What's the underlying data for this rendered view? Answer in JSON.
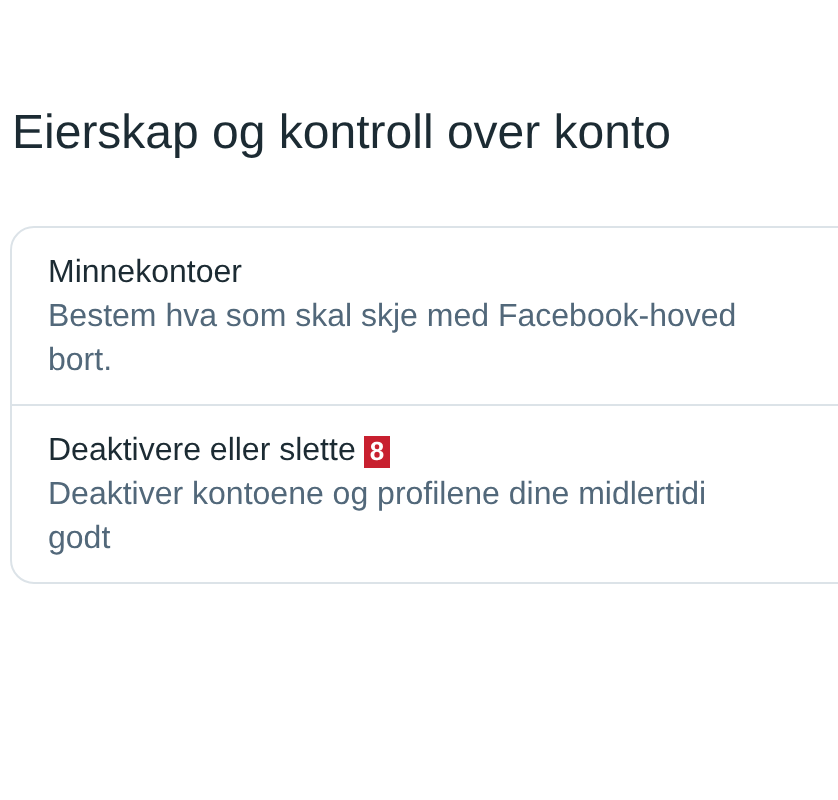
{
  "heading": "Eierskap og kontroll over konto",
  "items": [
    {
      "title": "Minnekontoer",
      "description_lines": [
        "Bestem hva som skal skje med Facebook-hoved",
        "bort."
      ]
    },
    {
      "title": "Deaktivere eller slette",
      "badge": "8",
      "description_lines": [
        "Deaktiver kontoene og profilene dine midlertidi",
        "godt"
      ]
    }
  ]
}
